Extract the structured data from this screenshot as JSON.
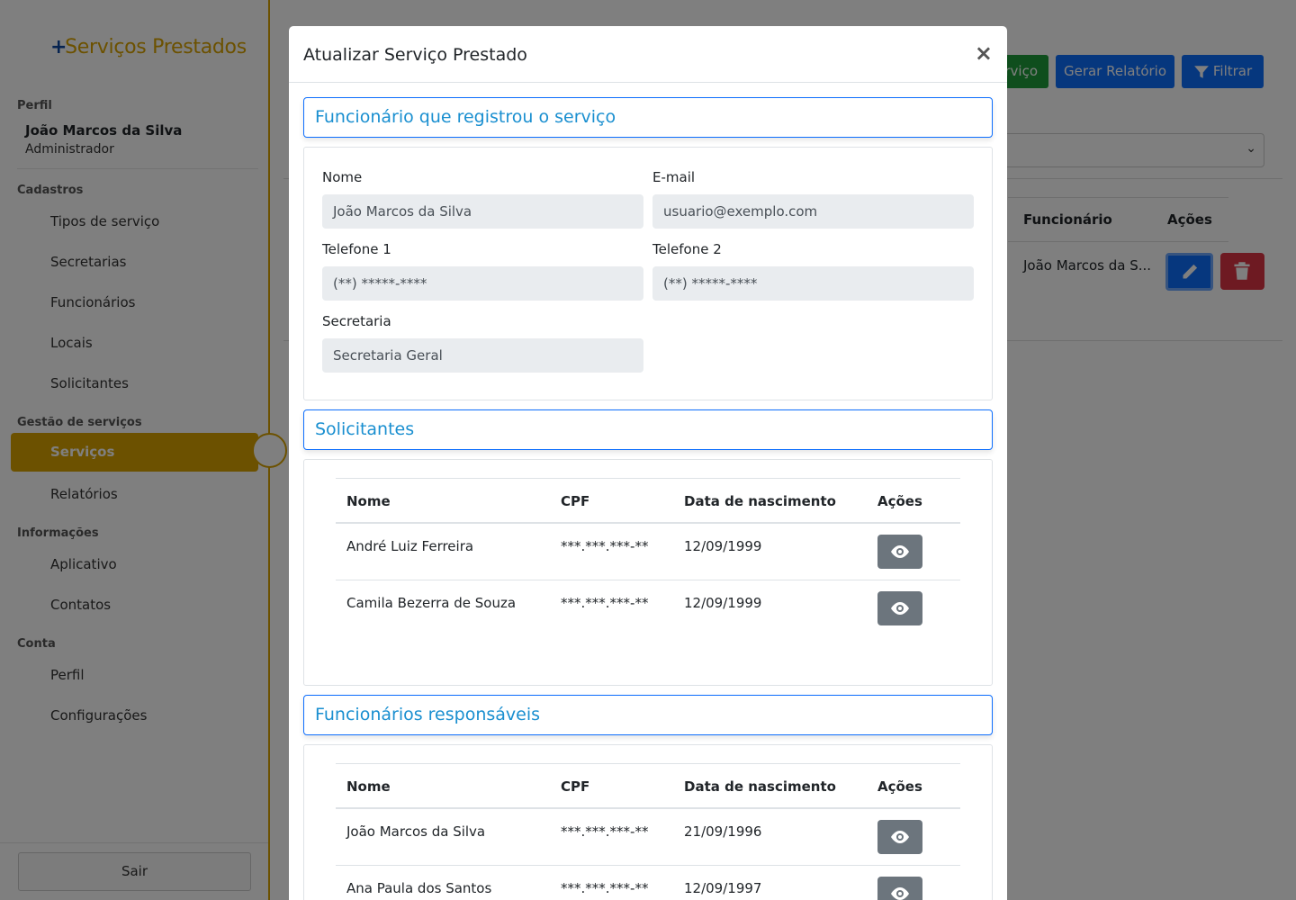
{
  "sidebar": {
    "brand_plus": "+",
    "brand_text": "Serviços Prestados",
    "profile_label": "Perfil",
    "user_name": "João Marcos da Silva",
    "user_role": "Administrador",
    "sections": [
      {
        "label": "Cadastros",
        "items": [
          "Tipos de serviço",
          "Secretarias",
          "Funcionários",
          "Locais",
          "Solicitantes"
        ]
      },
      {
        "label": "Gestão de serviços",
        "items": [
          "Serviços",
          "Relatórios"
        ]
      },
      {
        "label": "Informações",
        "items": [
          "Aplicativo",
          "Contatos"
        ]
      },
      {
        "label": "Conta",
        "items": [
          "Perfil",
          "Configurações"
        ]
      }
    ],
    "active_item": "Serviços",
    "logout_label": "Sair"
  },
  "background": {
    "new_service_partial": "rviço",
    "report_button": "Gerar Relatório",
    "filter_button": "Filtrar",
    "table_headers": [
      "Funcionário",
      "Ações"
    ],
    "row_employee": "João Marcos da S..."
  },
  "modal": {
    "title": "Atualizar Serviço Prestado",
    "close": "×",
    "registrant": {
      "heading": "Funcionário que registrou o serviço",
      "name_label": "Nome",
      "name_value": "João Marcos da Silva",
      "email_label": "E-mail",
      "email_value": "usuario@exemplo.com",
      "phone1_label": "Telefone 1",
      "phone1_value": "(**) *****-****",
      "phone2_label": "Telefone 2",
      "phone2_value": "(**) *****-****",
      "department_label": "Secretaria",
      "department_value": "Secretaria Geral"
    },
    "requesters": {
      "heading": "Solicitantes",
      "headers": [
        "Nome",
        "CPF",
        "Data de nascimento",
        "Ações"
      ],
      "rows": [
        {
          "name": "André Luiz Ferreira",
          "cpf": "***.***.***-**",
          "birth": "12/09/1999"
        },
        {
          "name": "Camila Bezerra de Souza",
          "cpf": "***.***.***-**",
          "birth": "12/09/1999"
        }
      ]
    },
    "responsibles": {
      "heading": "Funcionários responsáveis",
      "headers": [
        "Nome",
        "CPF",
        "Data de nascimento",
        "Ações"
      ],
      "rows": [
        {
          "name": "João Marcos da Silva",
          "cpf": "***.***.***-**",
          "birth": "21/09/1996"
        },
        {
          "name": "Ana Paula dos Santos",
          "cpf": "***.***.***-**",
          "birth": "12/09/1997"
        }
      ]
    }
  },
  "colors": {
    "accent": "#d9a300",
    "primary": "#0d6efd",
    "success": "#1f9d3a",
    "danger": "#dc3545",
    "secondary": "#6c757d",
    "section_title": "#1a8fd0"
  }
}
